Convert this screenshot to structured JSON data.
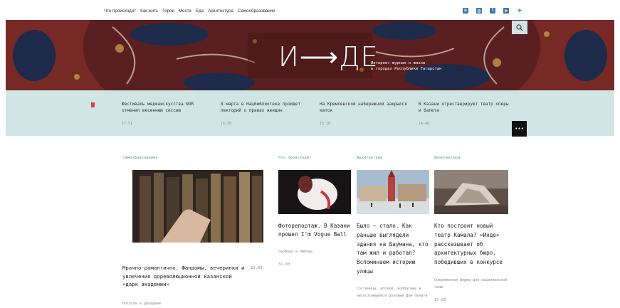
{
  "nav": {
    "items": [
      "Что происходит",
      "Как жить",
      "Герои",
      "Места",
      "Еда",
      "Архитектура",
      "Самообразование"
    ]
  },
  "socials": [
    "vk-icon",
    "instagram-icon",
    "facebook-icon",
    "telegram-icon",
    "twitter-icon"
  ],
  "hero": {
    "logo": "И⟶ДЕ",
    "tagline_line1": "Интернет-журнал о жизни",
    "tagline_line2": "в городах Республики Татарстан"
  },
  "ticker": {
    "items": [
      {
        "text": "Фестиваль медиаискусства NUR отменил весеннюю сессию",
        "time": "17:51"
      },
      {
        "text": "8 марта в Нацбиблиотеке пройдет лекторий о правах женщин",
        "time": "16:30"
      },
      {
        "text": "На Кремлевской набережной закрылся каток",
        "time": "15:18"
      },
      {
        "text": "В Казани отреставрируют театр оперы и балета",
        "time": "14:46"
      }
    ],
    "more_label": "•••"
  },
  "cards": [
    {
      "category": "Самообразование",
      "headline": "Мрачно-романтично. Фандомы, вечеринки и увлечения дореволюционной казанской «дарк академии»",
      "date": "22.03",
      "sub": "Погугли в декадене"
    },
    {
      "category": "Что происходит",
      "headline": "Фоторепортаж. В Казани прошел I'm Vogue Ball",
      "date": "31.03",
      "sub": "Свобода и любовь"
    },
    {
      "category": "Архитектура",
      "headline": "Было – стало. Как раньше выглядели здания на Баумана, кто там жил и работал? Вспоминаем историю улицы",
      "date": "",
      "sub": "Гостиницы, аптеки, колбасные и несостоявшийся розовый Дом печати"
    },
    {
      "category": "Архитектура",
      "headline": "Кто построит новый театр Камала? «Инде» рассказывает об архитектурных бюро, победивших в конкурсе",
      "date": "17.03",
      "sub": "Современная форма для национальной темы"
    }
  ],
  "colors": {
    "ticker_bg": "#cfe6e4",
    "accent": "#4a9a8f",
    "mark": "#e33a3a"
  }
}
